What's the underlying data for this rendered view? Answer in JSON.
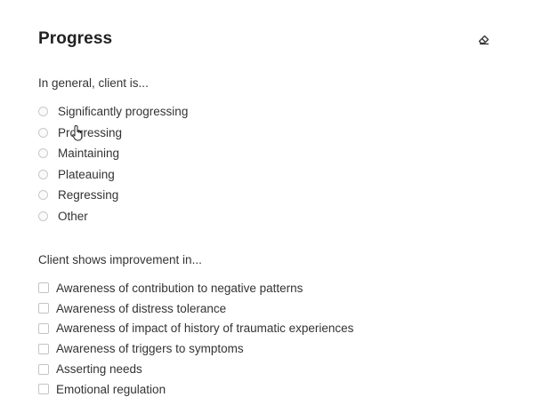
{
  "section": {
    "title": "Progress",
    "clear_icon": "eraser-icon"
  },
  "progress_question": {
    "label": "In general, client is...",
    "options": [
      "Significantly progressing",
      "Progressing",
      "Maintaining",
      "Plateauing",
      "Regressing",
      "Other"
    ]
  },
  "improvement_question": {
    "label": "Client shows improvement in...",
    "options": [
      "Awareness of contribution to negative patterns",
      "Awareness of distress tolerance",
      "Awareness of impact of history of traumatic experiences",
      "Awareness of triggers to symptoms",
      "Asserting needs",
      "Emotional regulation"
    ]
  },
  "cursor_icon": "hand-pointer-icon"
}
